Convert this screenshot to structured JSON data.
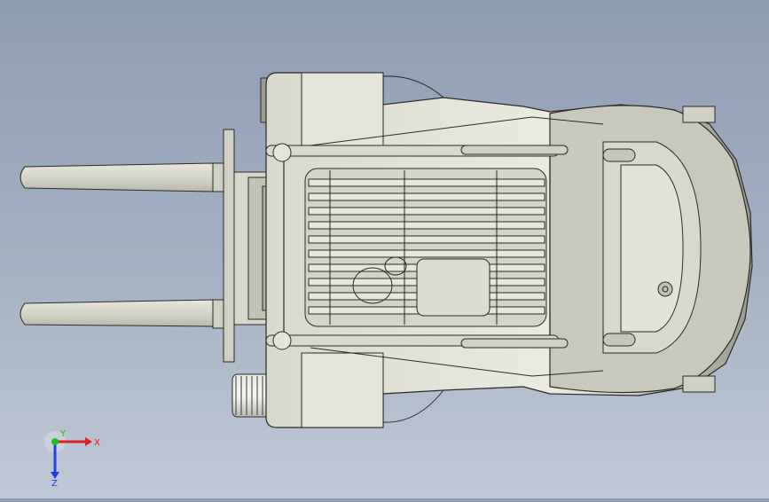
{
  "viewport": {
    "model": "forklift-top-view",
    "background_top": "#8e9cb2",
    "background_bottom": "#bfc8d6",
    "part_fill": "#dcdcd0",
    "part_dark": "#a8a89c",
    "edge_color": "#2a2a2a"
  },
  "triad": {
    "x_label": "X",
    "y_label": "Y",
    "z_label": "Z",
    "x_color": "#e02020",
    "y_color": "#20c020",
    "z_color": "#2040e0"
  }
}
